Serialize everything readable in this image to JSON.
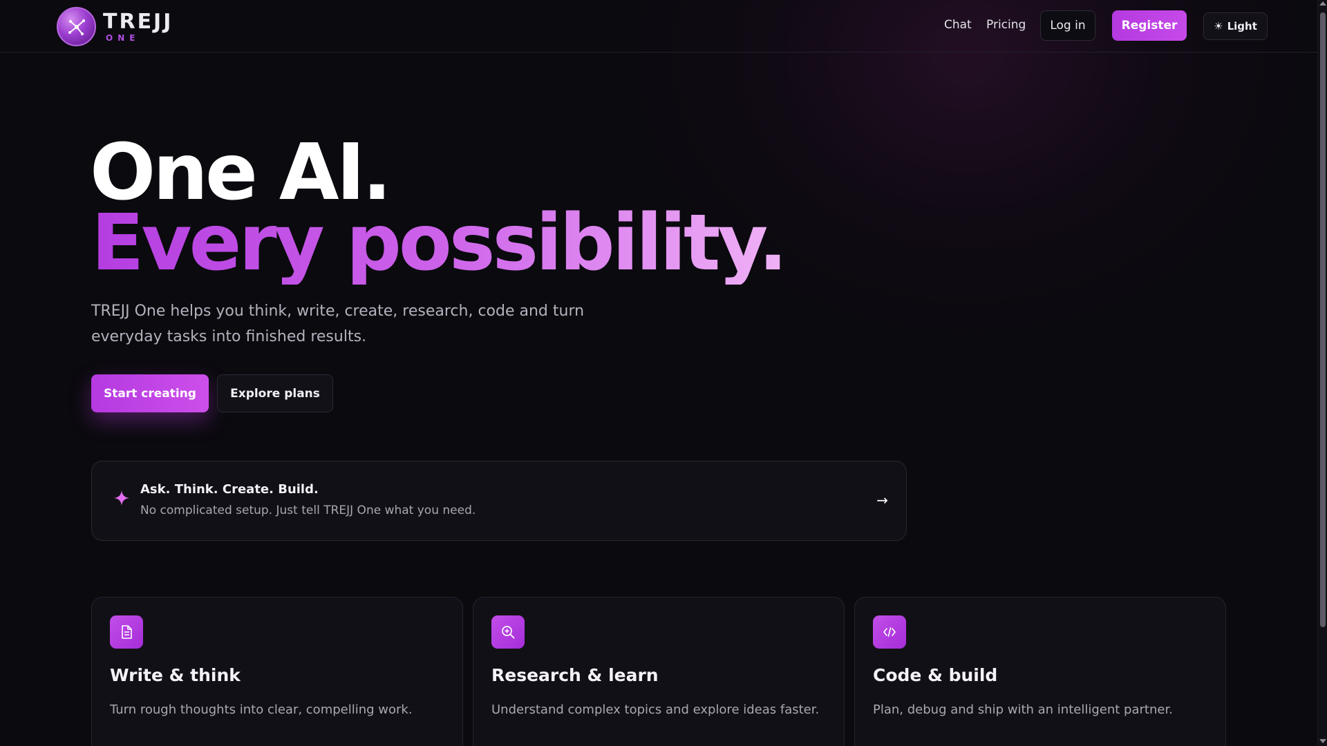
{
  "brand": {
    "name": "TREJJ",
    "sub": "ONE"
  },
  "nav": {
    "links": [
      "Chat",
      "Pricing"
    ],
    "login_label": "Log in",
    "register_label": "Register",
    "theme_label": "Light",
    "theme_icon": "sun-icon"
  },
  "hero": {
    "line1": "One AI.",
    "line2": "Every possibility.",
    "description": "TREJJ One helps you think, write, create, research, code and turn everyday tasks into finished results.",
    "primary_cta": "Start creating",
    "secondary_cta": "Explore plans"
  },
  "prompt": {
    "icon": "sparkle-icon",
    "title": "Ask. Think. Create. Build.",
    "subtitle": "No complicated setup. Just tell TREJJ One what you need.",
    "arrow": "→"
  },
  "features": [
    {
      "icon": "document-icon",
      "title": "Write & think",
      "description": "Turn rough thoughts into clear, compelling work."
    },
    {
      "icon": "search-icon",
      "title": "Research & learn",
      "description": "Understand complex topics and explore ideas faster."
    },
    {
      "icon": "code-icon",
      "title": "Code & build",
      "description": "Plan, debug and ship with an intelligent partner."
    }
  ],
  "colors": {
    "background": "#0b0a0f",
    "accent": "#c24ee8",
    "card": "#121017"
  }
}
